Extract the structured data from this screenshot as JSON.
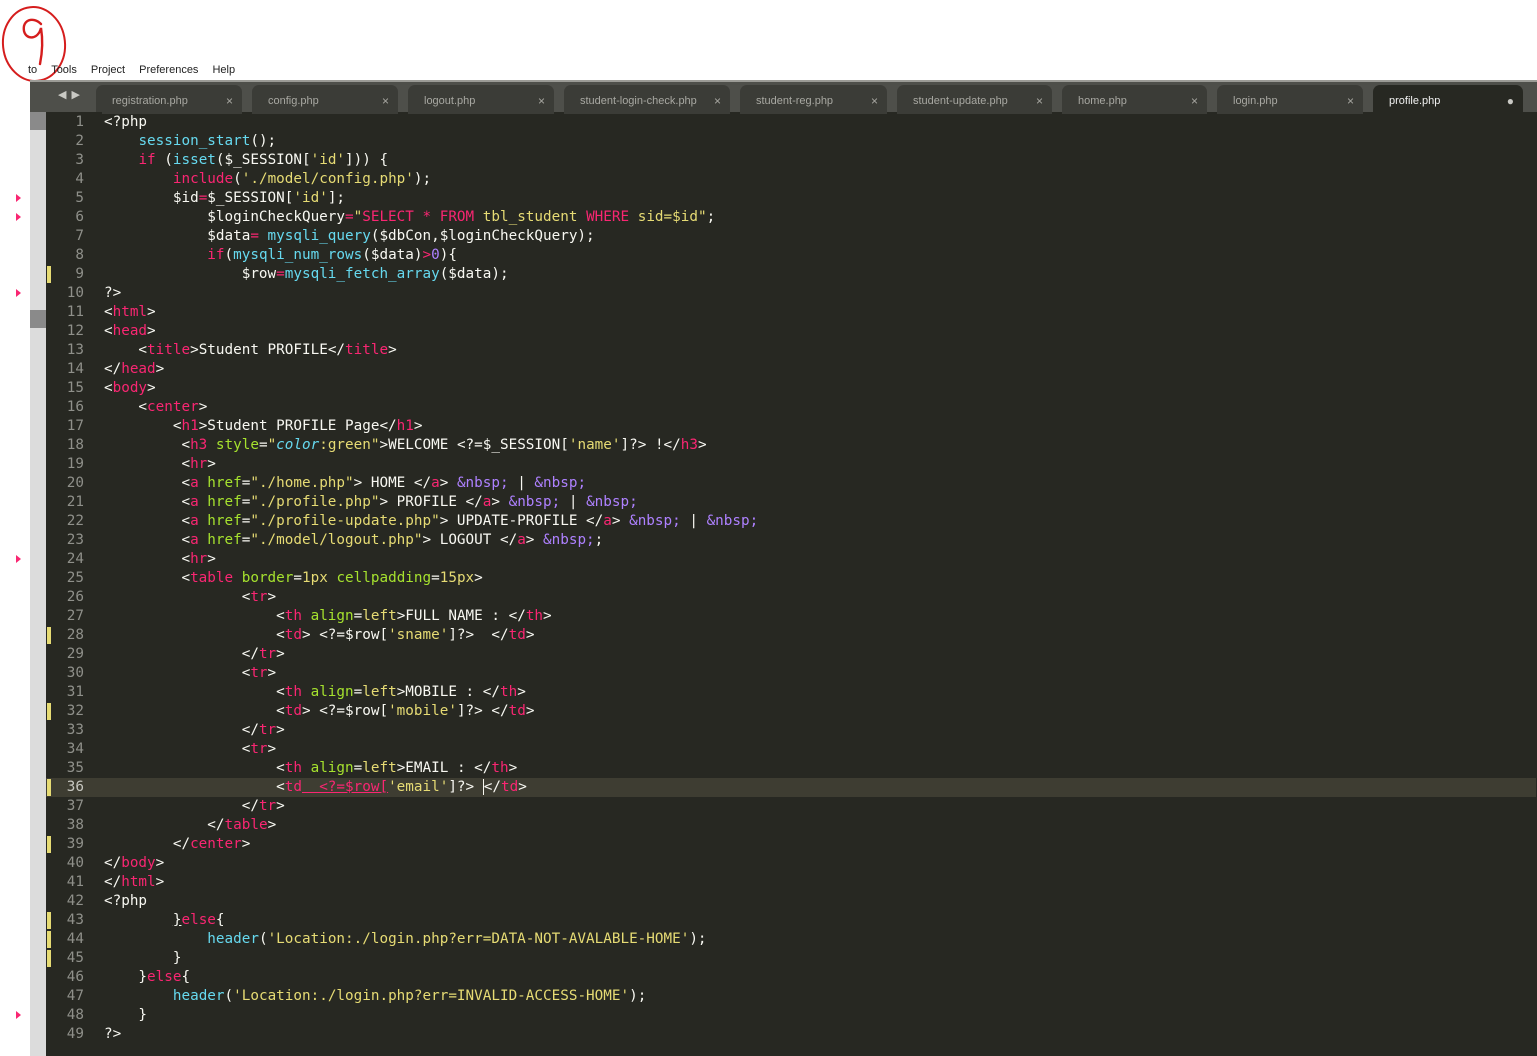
{
  "annotation": {
    "label": "9"
  },
  "menu": [
    "to",
    "Tools",
    "Project",
    "Preferences",
    "Help"
  ],
  "tabs": [
    {
      "label": "registration.php",
      "close": "×"
    },
    {
      "label": "config.php",
      "close": "×"
    },
    {
      "label": "logout.php",
      "close": "×"
    },
    {
      "label": "student-login-check.php",
      "close": "×"
    },
    {
      "label": "student-reg.php",
      "close": "×"
    },
    {
      "label": "student-update.php",
      "close": "×"
    },
    {
      "label": "home.php",
      "close": "×"
    },
    {
      "label": "login.php",
      "close": "×"
    },
    {
      "label": "profile.php",
      "close": "●"
    }
  ],
  "nav_arrows": "◀▶",
  "active_tab": 8,
  "current_line": 36,
  "colors": {
    "background": "#272822",
    "keyword": "#f92672",
    "function": "#66d9ef",
    "string": "#e6db74",
    "attribute": "#a6e22e",
    "entity": "#ae81ff",
    "gutter_text": "#8f908a",
    "modified_marker": "#e6db74"
  },
  "modified_lines": [
    9,
    28,
    32,
    36,
    39,
    43,
    44,
    45
  ],
  "warning_lines": [
    5,
    6,
    10,
    24,
    48
  ],
  "code": [
    [
      [
        "",
        "<?php"
      ]
    ],
    [
      [
        "",
        "    "
      ],
      [
        "f",
        "session_start"
      ],
      [
        "",
        "();"
      ]
    ],
    [
      [
        "",
        "    "
      ],
      [
        "k",
        "if"
      ],
      [
        "",
        " ("
      ],
      [
        "f",
        "isset"
      ],
      [
        "",
        "($_SESSION["
      ],
      [
        "s",
        "'id'"
      ],
      [
        "",
        "])) {"
      ]
    ],
    [
      [
        "",
        "        "
      ],
      [
        "k",
        "include"
      ],
      [
        "",
        "("
      ],
      [
        "s",
        "'./model/config.php'"
      ],
      [
        "",
        ");"
      ]
    ],
    [
      [
        "",
        "        $id"
      ],
      [
        "k",
        "="
      ],
      [
        "",
        "$_SESSION["
      ],
      [
        "s",
        "'id'"
      ],
      [
        "",
        "];"
      ]
    ],
    [
      [
        "",
        "            $loginCheckQuery"
      ],
      [
        "k",
        "="
      ],
      [
        "s",
        "\""
      ],
      [
        "k",
        "SELECT"
      ],
      [
        "s",
        " "
      ],
      [
        "k",
        "*"
      ],
      [
        "s",
        " "
      ],
      [
        "k",
        "FROM"
      ],
      [
        "s",
        " tbl_student "
      ],
      [
        "k",
        "WHERE"
      ],
      [
        "s",
        " sid=$id\""
      ],
      [
        "",
        ";"
      ]
    ],
    [
      [
        "",
        "            $data"
      ],
      [
        "k",
        "="
      ],
      [
        "",
        " "
      ],
      [
        "f",
        "mysqli_query"
      ],
      [
        "",
        "($dbCon,$loginCheckQuery);"
      ]
    ],
    [
      [
        "",
        "            "
      ],
      [
        "k",
        "if"
      ],
      [
        "",
        "("
      ],
      [
        "f",
        "mysqli_num_rows"
      ],
      [
        "",
        "($data)"
      ],
      [
        "k",
        ">"
      ],
      [
        "e",
        "0"
      ],
      [
        "",
        "){"
      ]
    ],
    [
      [
        "",
        "                $row"
      ],
      [
        "k",
        "="
      ],
      [
        "f",
        "mysqli_fetch_array"
      ],
      [
        "",
        "($data);"
      ]
    ],
    [
      [
        "",
        "?>"
      ]
    ],
    [
      [
        "",
        "<"
      ],
      [
        "k",
        "html"
      ],
      [
        "",
        ">"
      ]
    ],
    [
      [
        "",
        "<"
      ],
      [
        "k",
        "head"
      ],
      [
        "",
        ">"
      ]
    ],
    [
      [
        "",
        "    <"
      ],
      [
        "k",
        "title"
      ],
      [
        "",
        ">Student PROFILE</"
      ],
      [
        "k",
        "title"
      ],
      [
        "",
        ">"
      ]
    ],
    [
      [
        "",
        "</"
      ],
      [
        "k",
        "head"
      ],
      [
        "",
        ">"
      ]
    ],
    [
      [
        "",
        "<"
      ],
      [
        "k",
        "body"
      ],
      [
        "",
        ">"
      ]
    ],
    [
      [
        "",
        "    <"
      ],
      [
        "k",
        "center"
      ],
      [
        "",
        ">"
      ]
    ],
    [
      [
        "",
        "        <"
      ],
      [
        "k",
        "h1"
      ],
      [
        "",
        ">Student PROFILE Page</"
      ],
      [
        "k",
        "h1"
      ],
      [
        "",
        ">"
      ]
    ],
    [
      [
        "",
        "         <"
      ],
      [
        "k",
        "h3"
      ],
      [
        "",
        " "
      ],
      [
        "a",
        "style"
      ],
      [
        "",
        "="
      ],
      [
        "s",
        "\""
      ],
      [
        "i",
        "color"
      ],
      [
        "s",
        ":"
      ],
      [
        "s",
        "green\""
      ],
      [
        "",
        ">WELCOME <?=$_SESSION["
      ],
      [
        "s",
        "'name'"
      ],
      [
        "",
        "]?> !</"
      ],
      [
        "k",
        "h3"
      ],
      [
        "",
        ">"
      ]
    ],
    [
      [
        "",
        "         <"
      ],
      [
        "k",
        "hr"
      ],
      [
        "",
        ">"
      ]
    ],
    [
      [
        "",
        "         <"
      ],
      [
        "k",
        "a"
      ],
      [
        "",
        " "
      ],
      [
        "a",
        "href"
      ],
      [
        "",
        "="
      ],
      [
        "s",
        "\"./home.php\""
      ],
      [
        "",
        "> HOME </"
      ],
      [
        "k",
        "a"
      ],
      [
        "",
        "> "
      ],
      [
        "e",
        "&nbsp;"
      ],
      [
        "",
        " | "
      ],
      [
        "e",
        "&nbsp;"
      ]
    ],
    [
      [
        "",
        "         <"
      ],
      [
        "k",
        "a"
      ],
      [
        "",
        " "
      ],
      [
        "a",
        "href"
      ],
      [
        "",
        "="
      ],
      [
        "s",
        "\"./profile.php\""
      ],
      [
        "",
        "> PROFILE </"
      ],
      [
        "k",
        "a"
      ],
      [
        "",
        "> "
      ],
      [
        "e",
        "&nbsp;"
      ],
      [
        "",
        " | "
      ],
      [
        "e",
        "&nbsp;"
      ]
    ],
    [
      [
        "",
        "         <"
      ],
      [
        "k",
        "a"
      ],
      [
        "",
        " "
      ],
      [
        "a",
        "href"
      ],
      [
        "",
        "="
      ],
      [
        "s",
        "\"./profile-update.php\""
      ],
      [
        "",
        "> UPDATE-PROFILE </"
      ],
      [
        "k",
        "a"
      ],
      [
        "",
        "> "
      ],
      [
        "e",
        "&nbsp;"
      ],
      [
        "",
        " | "
      ],
      [
        "e",
        "&nbsp;"
      ]
    ],
    [
      [
        "",
        "         <"
      ],
      [
        "k",
        "a"
      ],
      [
        "",
        " "
      ],
      [
        "a",
        "href"
      ],
      [
        "",
        "="
      ],
      [
        "s",
        "\"./model/logout.php\""
      ],
      [
        "",
        "> LOGOUT </"
      ],
      [
        "k",
        "a"
      ],
      [
        "",
        "> "
      ],
      [
        "e",
        "&nbsp;"
      ],
      [
        "",
        ";"
      ]
    ],
    [
      [
        "",
        "         <"
      ],
      [
        "k",
        "hr"
      ],
      [
        "",
        ">"
      ]
    ],
    [
      [
        "",
        "         <"
      ],
      [
        "k",
        "table"
      ],
      [
        "",
        " "
      ],
      [
        "a",
        "border"
      ],
      [
        "",
        "="
      ],
      [
        "s",
        "1px"
      ],
      [
        "",
        " "
      ],
      [
        "a",
        "cellpadding"
      ],
      [
        "",
        "="
      ],
      [
        "s",
        "15px"
      ],
      [
        "",
        ">"
      ]
    ],
    [
      [
        "",
        "                <"
      ],
      [
        "k",
        "tr"
      ],
      [
        "",
        ">"
      ]
    ],
    [
      [
        "",
        "                    <"
      ],
      [
        "k",
        "th"
      ],
      [
        "",
        " "
      ],
      [
        "a",
        "align"
      ],
      [
        "",
        "="
      ],
      [
        "s",
        "left"
      ],
      [
        "",
        ">FULL NAME : </"
      ],
      [
        "k",
        "th"
      ],
      [
        "",
        ">"
      ]
    ],
    [
      [
        "",
        "                    <"
      ],
      [
        "k",
        "td"
      ],
      [
        "",
        "> <?=$row["
      ],
      [
        "s",
        "'sname'"
      ],
      [
        "",
        "]?>  </"
      ],
      [
        "k",
        "td"
      ],
      [
        "",
        ">"
      ]
    ],
    [
      [
        "",
        "                </"
      ],
      [
        "k",
        "tr"
      ],
      [
        "",
        ">"
      ]
    ],
    [
      [
        "",
        "                <"
      ],
      [
        "k",
        "tr"
      ],
      [
        "",
        ">"
      ]
    ],
    [
      [
        "",
        "                    <"
      ],
      [
        "k",
        "th"
      ],
      [
        "",
        " "
      ],
      [
        "a",
        "align"
      ],
      [
        "",
        "="
      ],
      [
        "s",
        "left"
      ],
      [
        "",
        ">MOBILE : </"
      ],
      [
        "k",
        "th"
      ],
      [
        "",
        ">"
      ]
    ],
    [
      [
        "",
        "                    <"
      ],
      [
        "k",
        "td"
      ],
      [
        "",
        "> <?=$row["
      ],
      [
        "s",
        "'mobile'"
      ],
      [
        "",
        "]?> </"
      ],
      [
        "k",
        "td"
      ],
      [
        "",
        ">"
      ]
    ],
    [
      [
        "",
        "                </"
      ],
      [
        "k",
        "tr"
      ],
      [
        "",
        ">"
      ]
    ],
    [
      [
        "",
        "                <"
      ],
      [
        "k",
        "tr"
      ],
      [
        "",
        ">"
      ]
    ],
    [
      [
        "",
        "                    <"
      ],
      [
        "k",
        "th"
      ],
      [
        "",
        " "
      ],
      [
        "a",
        "align"
      ],
      [
        "",
        "="
      ],
      [
        "s",
        "left"
      ],
      [
        "",
        ">EMAIL : </"
      ],
      [
        "k",
        "th"
      ],
      [
        "",
        ">"
      ]
    ],
    [
      [
        "",
        "                    <"
      ],
      [
        "k",
        "td"
      ],
      [
        ">",
        "  <?=$row["
      ],
      [
        "s",
        "'email'"
      ],
      [
        "",
        "]?> "
      ],
      [
        "c",
        "<"
      ],
      [
        "",
        "/"
      ],
      [
        "k",
        "td"
      ],
      [
        "",
        ">"
      ]
    ],
    [
      [
        "",
        "                </"
      ],
      [
        "k",
        "tr"
      ],
      [
        "",
        ">"
      ]
    ],
    [
      [
        "",
        "            </"
      ],
      [
        "k",
        "table"
      ],
      [
        "",
        ">"
      ]
    ],
    [
      [
        "",
        "        </"
      ],
      [
        "k",
        "center"
      ],
      [
        "",
        ">"
      ]
    ],
    [
      [
        "",
        "</"
      ],
      [
        "k",
        "body"
      ],
      [
        "",
        ">"
      ]
    ],
    [
      [
        "",
        "</"
      ],
      [
        "k",
        "html"
      ],
      [
        "",
        ">"
      ]
    ],
    [
      [
        "",
        "<?php"
      ]
    ],
    [
      [
        "",
        "        "
      ],
      [
        "u",
        "}"
      ],
      [
        "k",
        "else"
      ],
      [
        "",
        "{"
      ]
    ],
    [
      [
        "",
        "            "
      ],
      [
        "f",
        "header"
      ],
      [
        "",
        "("
      ],
      [
        "s",
        "'Location:./login.php?err=DATA-NOT-AVALABLE-HOME'"
      ],
      [
        "",
        ");"
      ]
    ],
    [
      [
        "",
        "        }"
      ]
    ],
    [
      [
        "",
        "    }"
      ],
      [
        "k",
        "else"
      ],
      [
        "",
        "{"
      ]
    ],
    [
      [
        "",
        "        "
      ],
      [
        "f",
        "header"
      ],
      [
        "",
        "("
      ],
      [
        "s",
        "'Location:./login.php?err=INVALID-ACCESS-HOME'"
      ],
      [
        "",
        ");"
      ]
    ],
    [
      [
        "",
        "    }"
      ]
    ],
    [
      [
        "",
        "?>"
      ]
    ]
  ]
}
